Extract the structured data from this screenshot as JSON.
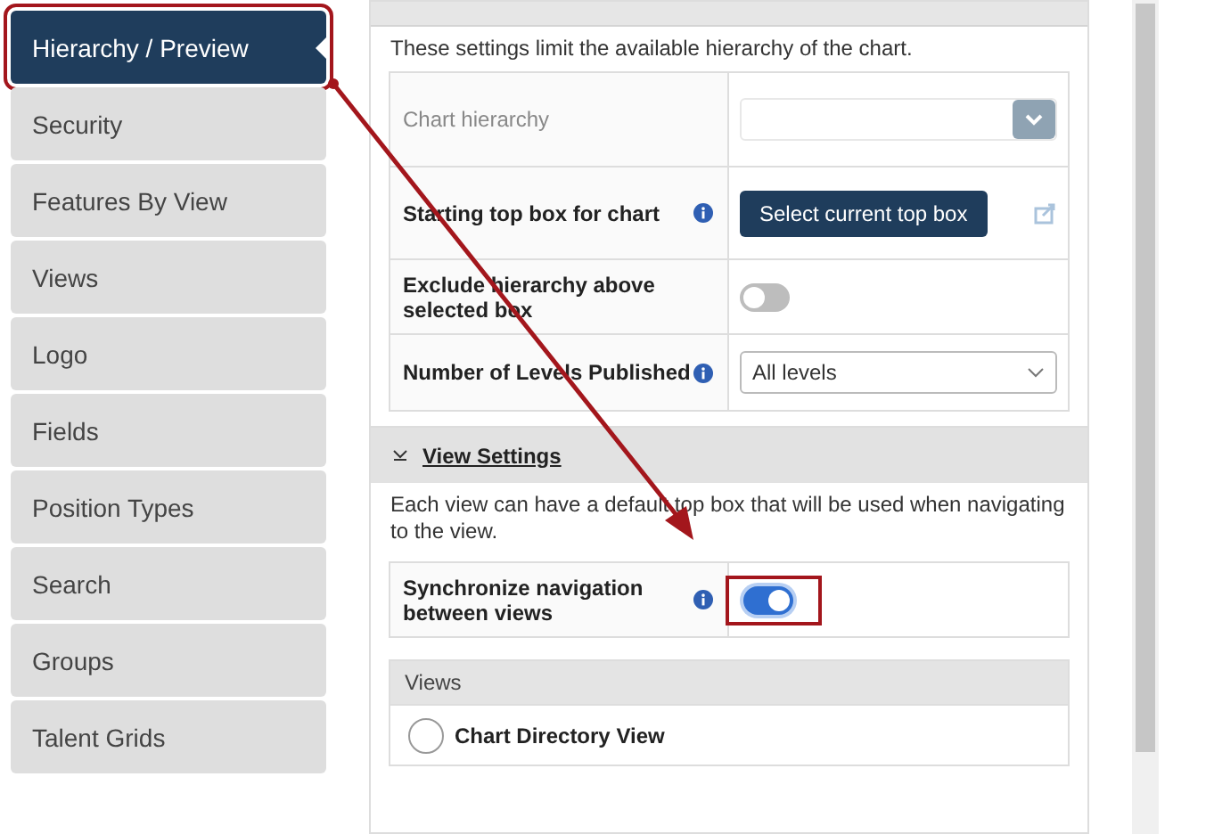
{
  "sidebar": {
    "items": [
      {
        "label": "Hierarchy / Preview",
        "selected": true
      },
      {
        "label": "Security",
        "selected": false
      },
      {
        "label": "Features By View",
        "selected": false
      },
      {
        "label": "Views",
        "selected": false
      },
      {
        "label": "Logo",
        "selected": false
      },
      {
        "label": "Fields",
        "selected": false
      },
      {
        "label": "Position Types",
        "selected": false
      },
      {
        "label": "Search",
        "selected": false
      },
      {
        "label": "Groups",
        "selected": false
      },
      {
        "label": "Talent Grids",
        "selected": false
      }
    ]
  },
  "hierarchy_settings": {
    "description": "These settings limit the available hierarchy of the chart.",
    "rows": [
      {
        "kind": "select",
        "label": "Chart hierarchy",
        "disabled": true,
        "info": false
      },
      {
        "kind": "button",
        "label": "Starting top box for chart",
        "disabled": false,
        "info": true,
        "button": "Select current top box"
      },
      {
        "kind": "toggle",
        "label": "Exclude hierarchy above selected box",
        "disabled": false,
        "info": false,
        "on": false
      },
      {
        "kind": "dropdown",
        "label": "Number of Levels Published",
        "disabled": false,
        "info": true,
        "value": "All levels"
      }
    ]
  },
  "view_settings": {
    "title": "View Settings",
    "expanded": true,
    "description": "Each view can have a default top box that will be used when navigating to the view.",
    "sync": {
      "label": "Synchronize navigation between views",
      "info": true,
      "on": true
    },
    "views": {
      "header": "Views",
      "items": [
        {
          "label": "Chart Directory View",
          "selected": false
        }
      ]
    }
  }
}
